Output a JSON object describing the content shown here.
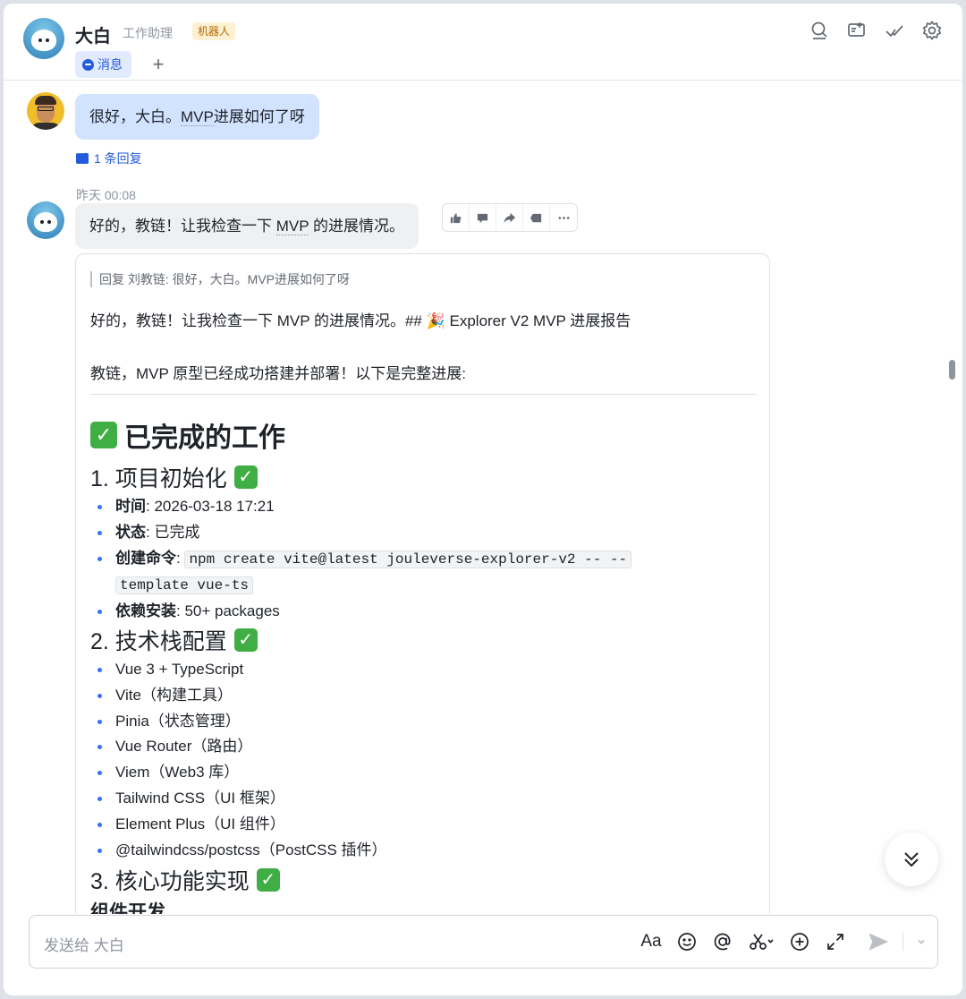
{
  "header": {
    "name": "大白",
    "description": "工作助理",
    "badge": "机器人",
    "tab_message": "消息",
    "tab_add": "+"
  },
  "messages": {
    "user_text_pre": "很好，大白。",
    "user_text_mvp": "MVP",
    "user_text_post": "进展如何了呀",
    "reply_count": "1 条回复",
    "timestamp": "昨天 00:08",
    "bot_text_pre": "好的，教链！让我检查一下 ",
    "bot_text_mvp": "MVP",
    "bot_text_post": " 的进展情况。"
  },
  "card": {
    "quote": "回复 刘教链: 很好，大白。MVP进展如何了呀",
    "p1": "好的，教链！让我检查一下 MVP 的进展情况。## 🎉 Explorer V2 MVP 进展报告",
    "p2": "教链，MVP 原型已经成功搭建并部署！以下是完整进展:",
    "h1": "已完成的工作",
    "sec1": {
      "title": "1. 项目初始化",
      "time_label": "时间",
      "time_value": "2026-03-18 17:21",
      "status_label": "状态",
      "status_value": "已完成",
      "cmd_label": "创建命令",
      "cmd_line1": "npm create vite@latest jouleverse-explorer-v2 -- --",
      "cmd_line2": "template vue-ts",
      "deps_label": "依赖安装",
      "deps_value": "50+ packages"
    },
    "sec2": {
      "title": "2. 技术栈配置",
      "items": [
        "Vue 3 + TypeScript",
        "Vite（构建工具）",
        "Pinia（状态管理）",
        "Vue Router（路由）",
        "Viem（Web3 库）",
        "Tailwind CSS（UI 框架）",
        "Element Plus（UI 组件）",
        "@tailwindcss/postcss（PostCSS 插件）"
      ]
    },
    "sec3": {
      "title": "3. 核心功能实现",
      "sub": "组件开发"
    }
  },
  "composer": {
    "placeholder": "发送给 大白",
    "font_tool": "Aa"
  },
  "colors": {
    "accent": "#245bdb",
    "user_bubble": "#d1e3ff",
    "bot_bubble": "#eff0f1",
    "check_green": "#3fae44"
  }
}
